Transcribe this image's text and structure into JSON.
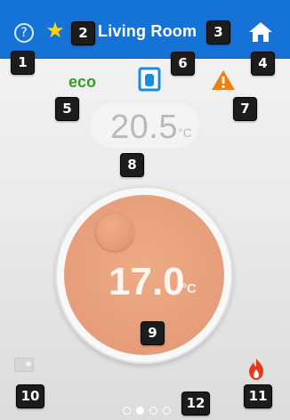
{
  "header": {
    "title": "Living Room",
    "help_icon": "question-circle-icon",
    "favorite_icon": "star-icon",
    "home_icon": "home-icon",
    "background_color": "#1572d6",
    "star_color": "#ffd400"
  },
  "status": {
    "eco_label": "eco",
    "eco_color": "#3a9a2a",
    "window_icon": "window-open-icon",
    "window_color": "#1a8de0",
    "warning_icon": "warning-triangle-icon",
    "warning_color": "#f07f10"
  },
  "current_temperature": {
    "value": "20.5",
    "unit": "°C"
  },
  "setpoint": {
    "value": "17.0",
    "unit": "°C",
    "dial_color": "#e79e7a"
  },
  "bottom": {
    "mode_icon": "toggle-switch-icon",
    "flame_icon": "flame-icon",
    "flame_color": "#e53a1a"
  },
  "pagination": {
    "total": 4,
    "active_index": 1
  },
  "callouts": [
    "1",
    "2",
    "3",
    "4",
    "5",
    "6",
    "7",
    "8",
    "9",
    "10",
    "11",
    "12"
  ]
}
